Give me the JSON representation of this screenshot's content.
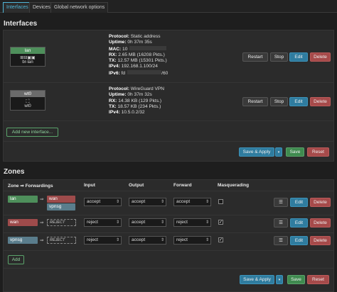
{
  "tabs": [
    "Interfaces",
    "Devices",
    "Global network options"
  ],
  "interfaces_title": "Interfaces",
  "interfaces": [
    {
      "name": "lan",
      "device": "br-lan",
      "color": "#4e8f5b",
      "info": [
        {
          "k": "Protocol:",
          "v": " Static address"
        },
        {
          "k": "Uptime:",
          "v": " 0h 37m 35s"
        },
        {
          "k": "MAC:",
          "v": " 10"
        },
        {
          "k": "RX:",
          "v": " 2.65 MB (16208 Pkts.)"
        },
        {
          "k": "TX:",
          "v": " 12.57 MB (15301 Pkts.)"
        },
        {
          "k": "IPv4:",
          "v": " 192.168.1.100/24"
        },
        {
          "k": "IPv6:",
          "v": " fd"
        },
        {
          "k": "",
          "v": "/60"
        }
      ]
    },
    {
      "name": "wt0",
      "device": "wt0",
      "color": "#6b6b6b",
      "info": [
        {
          "k": "Protocol:",
          "v": " WireGuard VPN"
        },
        {
          "k": "Uptime:",
          "v": " 0h 37m 32s"
        },
        {
          "k": "RX:",
          "v": " 14.38 KB (129 Pkts.)"
        },
        {
          "k": "TX:",
          "v": " 18.57 KB (234 Pkts.)"
        },
        {
          "k": "IPv4:",
          "v": " 10.5.0.2/32"
        }
      ]
    }
  ],
  "iface_buttons": {
    "restart": "Restart",
    "stop": "Stop",
    "edit": "Edit",
    "delete": "Delete"
  },
  "add_interface": "Add new interface...",
  "save_apply": "Save & Apply",
  "save": "Save",
  "reset": "Reset",
  "zones_title": "Zones",
  "zone_headers": {
    "zone": "Zone ⇒ Forwardings",
    "input": "Input",
    "output": "Output",
    "forward": "Forward",
    "masq": "Masquerading"
  },
  "zones": [
    {
      "name": "lan",
      "color": "#4e8f5b",
      "targets": [
        {
          "name": "wan",
          "color": "#9e4b4b"
        },
        {
          "name": "vpnsg",
          "color": "#5a7d8c"
        }
      ],
      "input": "accept",
      "output": "accept",
      "forward": "accept",
      "masq": false
    },
    {
      "name": "wan",
      "color": "#9e4b4b",
      "reject": "REJECT",
      "input": "reject",
      "output": "accept",
      "forward": "reject",
      "masq": true
    },
    {
      "name": "vpnsg",
      "color": "#5a7d8c",
      "reject": "REJECT",
      "input": "reject",
      "output": "accept",
      "forward": "reject",
      "masq": true
    }
  ],
  "zone_buttons": {
    "menu": "☰",
    "edit": "Edit",
    "delete": "Delete"
  },
  "add": "Add"
}
